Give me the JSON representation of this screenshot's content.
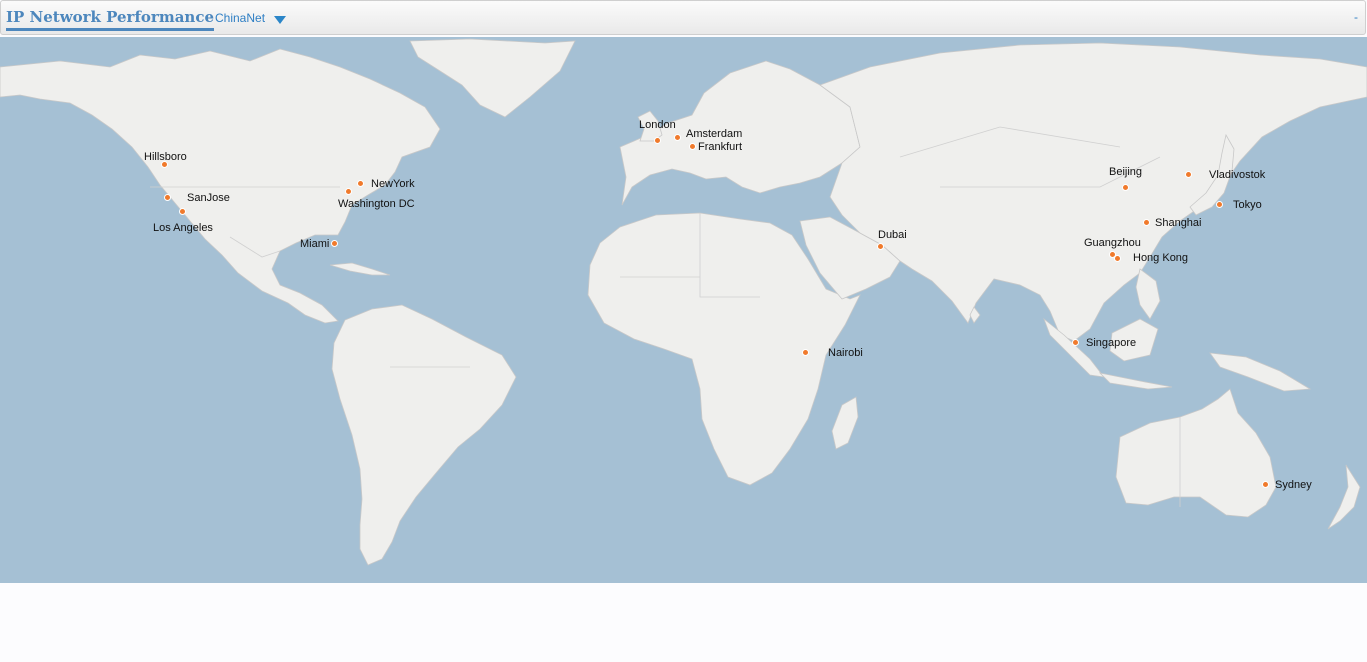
{
  "header": {
    "title": "IP Network Performance",
    "network_label": "ChinaNet",
    "right_text": "-"
  },
  "map": {
    "marker_color": "#f07a2c",
    "ocean_color": "#a5c0d4",
    "land_color": "#efefed",
    "cities": [
      {
        "name": "Hillsboro"
      },
      {
        "name": "SanJose"
      },
      {
        "name": "Los Angeles"
      },
      {
        "name": "NewYork"
      },
      {
        "name": "Washington DC"
      },
      {
        "name": "Miami"
      },
      {
        "name": "London"
      },
      {
        "name": "Amsterdam"
      },
      {
        "name": "Frankfurt"
      },
      {
        "name": "Dubai"
      },
      {
        "name": "Nairobi"
      },
      {
        "name": "Beijing"
      },
      {
        "name": "Vladivostok"
      },
      {
        "name": "Tokyo"
      },
      {
        "name": "Shanghai"
      },
      {
        "name": "Guangzhou"
      },
      {
        "name": "Hong Kong"
      },
      {
        "name": "Singapore"
      },
      {
        "name": "Sydney"
      }
    ]
  }
}
